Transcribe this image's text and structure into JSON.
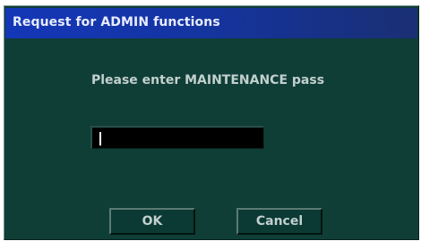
{
  "dialog": {
    "title": "Request for ADMIN functions",
    "prompt": "Please enter MAINTENANCE pass",
    "password_field": {
      "value": "",
      "placeholder": ""
    },
    "buttons": {
      "ok_label": "OK",
      "cancel_label": "Cancel"
    }
  },
  "colors": {
    "background": "#0f3e37",
    "title_bar": "#1437b8",
    "title_text": "#e8ecff",
    "text": "#c3d0ce",
    "input_background": "#000000"
  }
}
